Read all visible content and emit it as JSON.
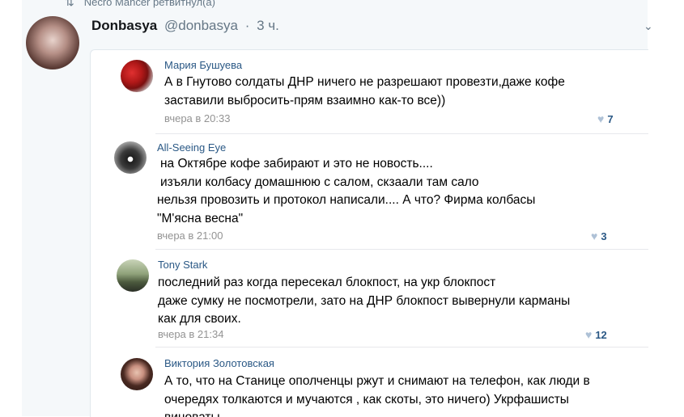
{
  "retweet": {
    "text": "Necro Mancer ретвитнул(а)"
  },
  "tweet": {
    "author_name": "Donbasya",
    "handle": "@donbasya",
    "separator": "·",
    "time": "3 ч."
  },
  "comments": [
    {
      "name": "Мария Бушуева",
      "lines": [
        "А в Гнутово солдаты ДНР ничего не разрешают провезти,даже кофе",
        "заставили выбросить-прям взаимно как-то все))"
      ],
      "time": "вчера в 20:33",
      "likes": "7"
    },
    {
      "name": "All-Seeing Eye",
      "lines": [
        "на Октябре кофе забирают и это не новость....",
        "изъяли колбасу домашнюю с салом, скзаали там сало",
        "нельзя провозить и протокол написали.... А что? Фирма колбасы",
        "\"М'ясна весна\""
      ],
      "time": "вчера в 21:00",
      "likes": "3"
    },
    {
      "name": "Tony Stark",
      "lines": [
        "последний раз когда пересекал блокпост, на укр блокпост",
        "даже сумку не посмотрели, зато на ДНР блокпост вывернули карманы",
        "как для своих."
      ],
      "time": "вчера в 21:34",
      "likes": "12"
    },
    {
      "name": "Виктория Золотовская",
      "lines": [
        "А то, что на Станице ополченцы ржут и снимают на телефон, как люди в",
        "очередях толкаются и мучаются , как скоты, это ничего) Укрфашисты",
        "виноваты"
      ]
    }
  ]
}
